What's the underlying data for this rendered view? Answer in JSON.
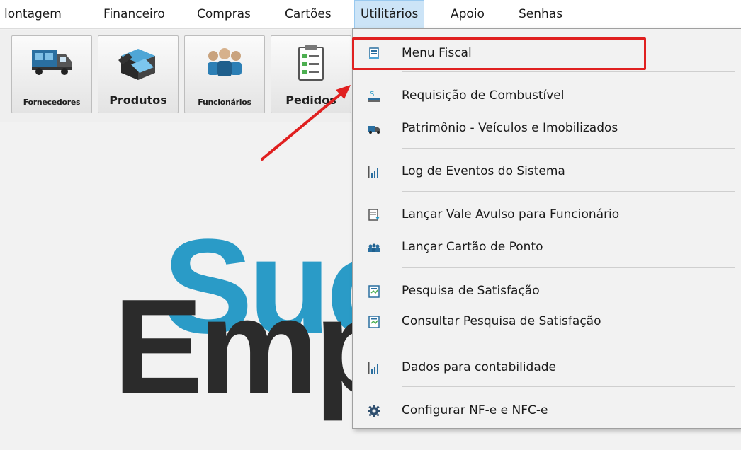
{
  "menubar": {
    "items": [
      "lontagem",
      "Financeiro",
      "Compras",
      "Cartões",
      "Utilitários",
      "Apoio",
      "Senhas"
    ]
  },
  "toolbar": {
    "buttons": [
      "Fornecedores",
      "Produtos",
      "Funcionários",
      "Pedidos"
    ]
  },
  "logo": {
    "line1": "Suc",
    "line2": "Emp"
  },
  "dropdown": {
    "items": [
      "Menu Fiscal",
      "Requisição de Combustível",
      "Patrimônio - Veículos e Imobilizados",
      "Log de Eventos do Sistema",
      "Lançar Vale Avulso para Funcionário",
      "Lançar Cartão de Ponto",
      "Pesquisa de Satisfação",
      "Consultar Pesquisa de Satisfação",
      "Dados para contabilidade",
      "Configurar NF-e e NFC-e"
    ]
  },
  "colors": {
    "menu_active_bg": "#cce4f7",
    "highlight_box": "#e02020",
    "annotation_arrow": "#e02020",
    "logo_blue": "#2a9bc7",
    "logo_dark": "#2b2b2b"
  },
  "icons": {
    "dropdown": [
      "receipt-icon",
      "fuel-icon",
      "truck-icon",
      "chart-icon",
      "voucher-icon",
      "people-icon",
      "survey-icon",
      "survey-icon",
      "chart-icon",
      "gear-icon"
    ]
  }
}
